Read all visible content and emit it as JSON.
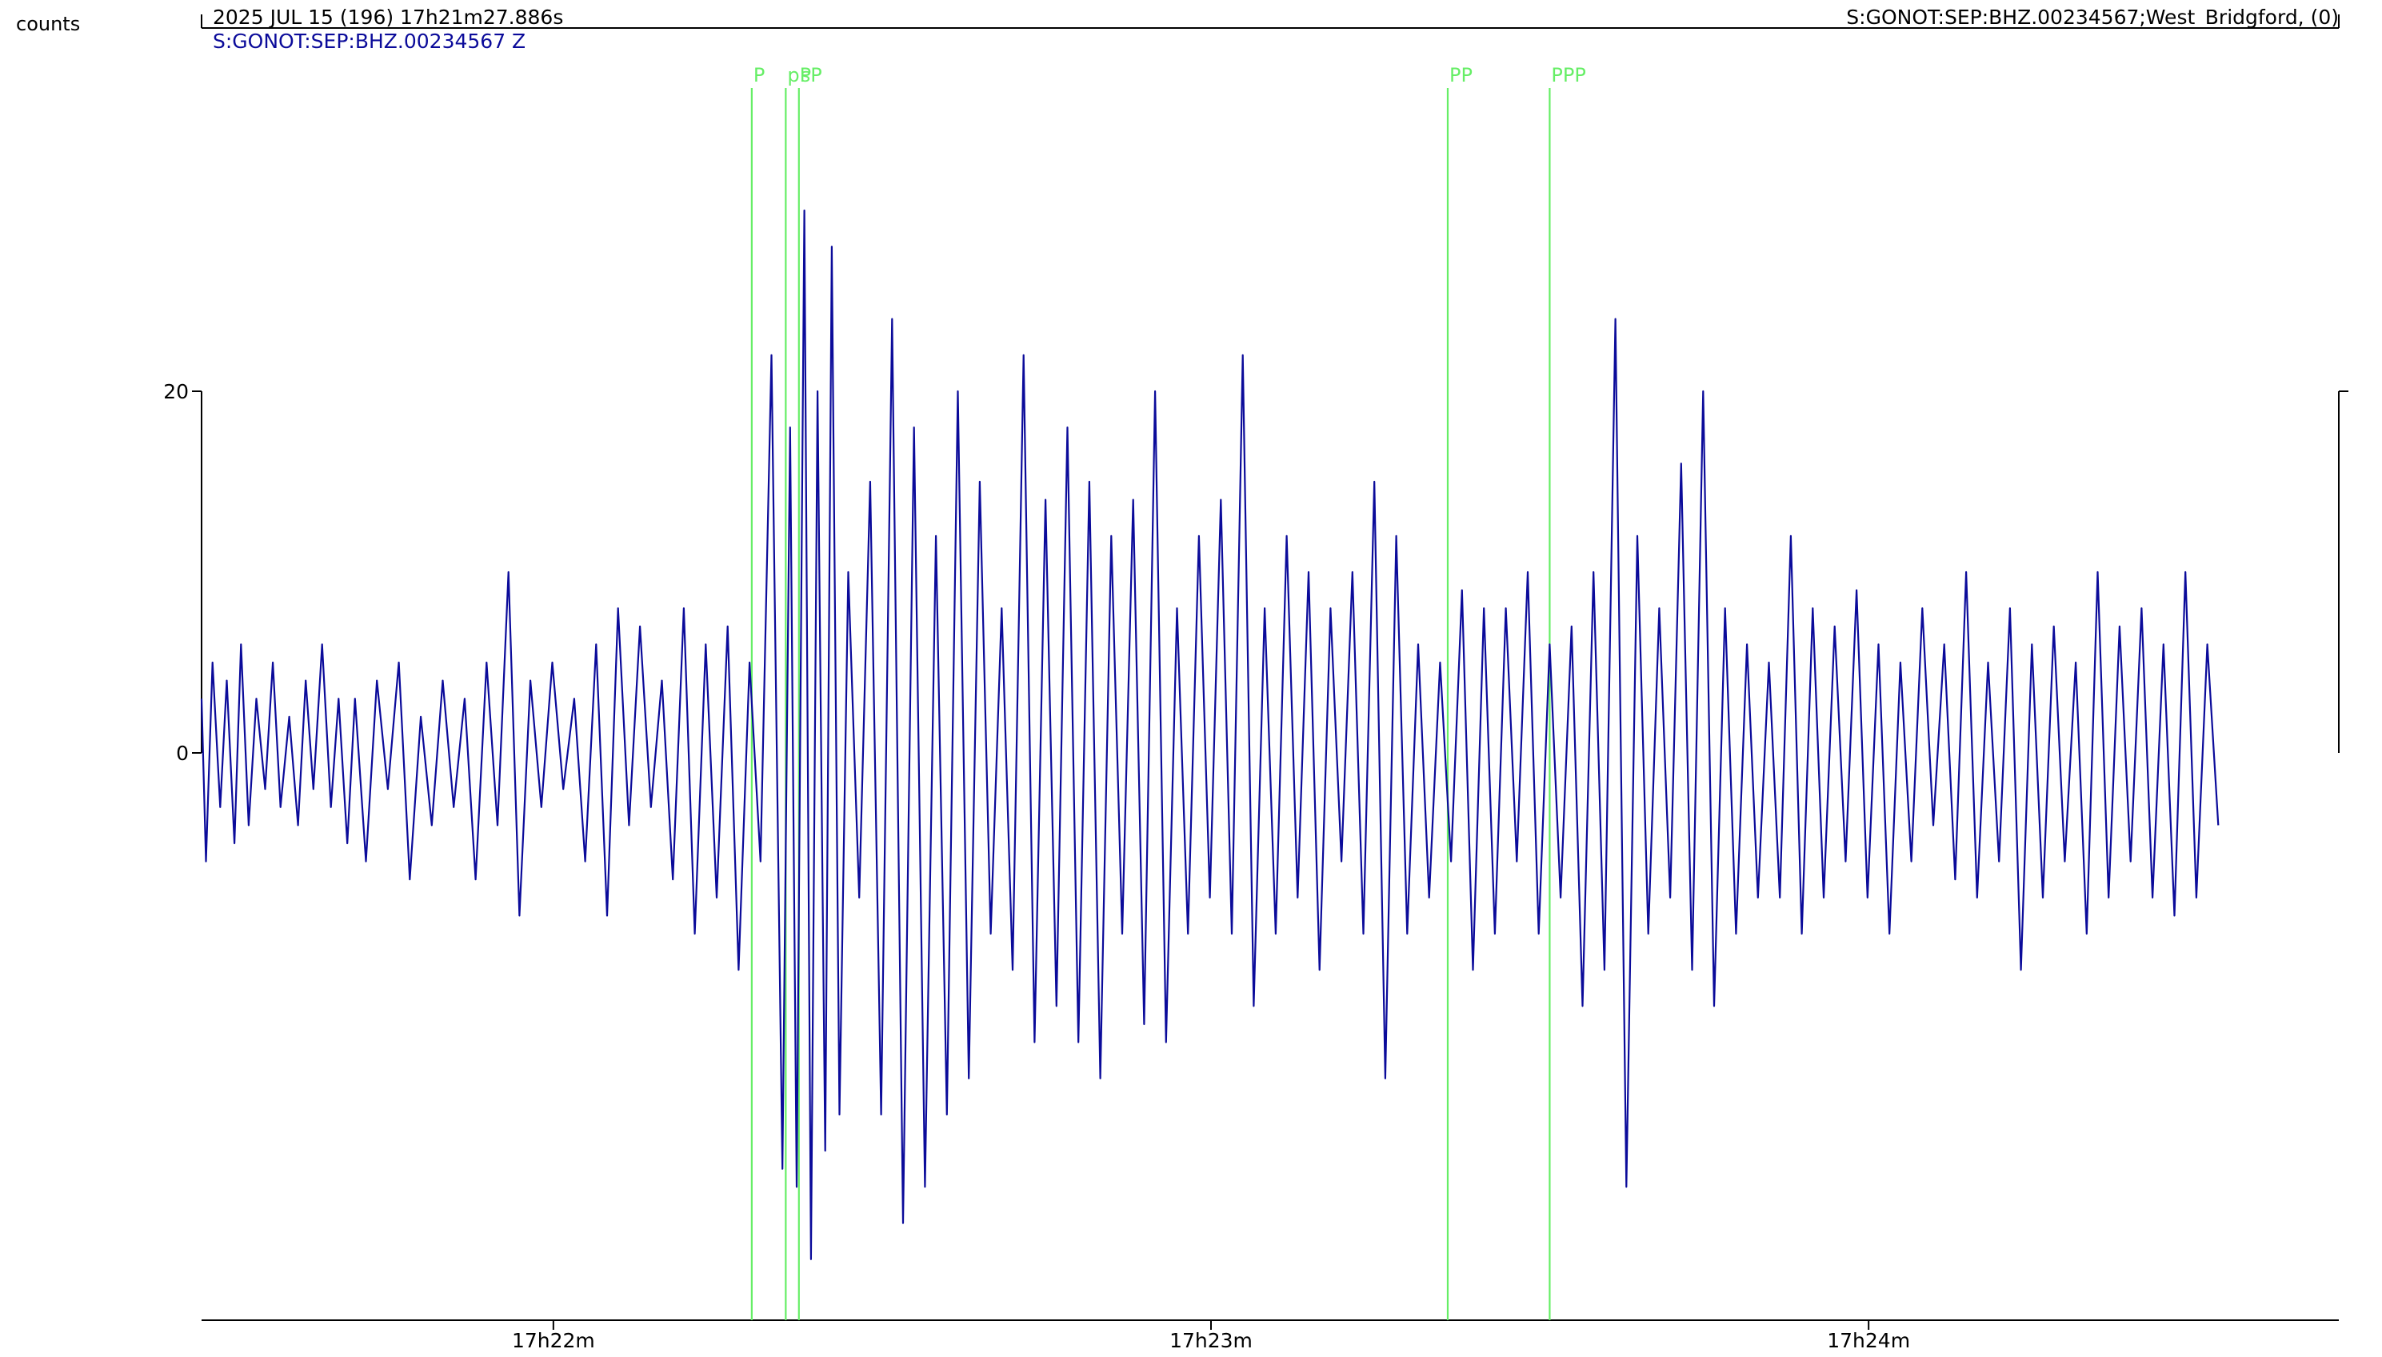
{
  "header": {
    "y_unit": "counts",
    "datetime": "2025 JUL 15 (196)  17h21m27.886s",
    "station_info": "S:GONOT:SEP:BHZ.00234567;West_Bridgford, (0)",
    "trace_label": "S:GONOT:SEP:BHZ.00234567 Z"
  },
  "colors": {
    "trace": "#0b0b9a",
    "phase_marker": "#66ee66",
    "pick": "#ee4444",
    "axis": "#000000",
    "background": "#ffffff"
  },
  "chart_data": {
    "type": "line",
    "x_unit": "seconds after 17h21m27.886s",
    "xlim": [
      0,
      195
    ],
    "ylim": [
      -40,
      40
    ],
    "y_ticks": [
      0,
      20
    ],
    "x_ticks": [
      {
        "t": 32.1,
        "label": "17h22m"
      },
      {
        "t": 92.1,
        "label": "17h23m"
      },
      {
        "t": 152.1,
        "label": "17h24m"
      }
    ],
    "phases": [
      {
        "name": "P",
        "t": 50.2
      },
      {
        "name": "pP",
        "t": 53.3
      },
      {
        "name": "sP",
        "t": 54.5
      },
      {
        "name": "PP",
        "t": 113.7
      },
      {
        "name": "PPP",
        "t": 123.0
      }
    ],
    "series": [
      {
        "t": [
          0.0,
          0.4,
          1.0,
          1.7,
          2.3,
          3.0,
          3.6,
          4.3,
          5.0,
          5.8,
          6.5,
          7.2,
          8.0,
          8.8,
          9.5,
          10.2,
          11.0,
          11.8,
          12.5,
          13.3,
          14.0,
          15.0,
          16.0,
          17.0,
          18.0,
          19.0,
          20.0,
          21.0,
          22.0,
          23.0,
          24.0,
          25.0,
          26.0,
          27.0,
          28.0,
          29.0,
          30.0,
          31.0,
          32.0,
          33.0,
          34.0,
          35.0,
          36.0,
          37.0,
          38.0,
          39.0,
          40.0,
          41.0,
          42.0,
          43.0,
          44.0,
          45.0,
          46.0,
          47.0,
          48.0,
          49.0,
          50.0,
          51.0,
          52.0,
          53.0,
          53.7,
          54.3,
          55.0,
          55.6,
          56.2,
          56.9,
          57.5,
          58.2,
          59.0,
          60.0,
          61.0,
          62.0,
          63.0,
          64.0,
          65.0,
          66.0,
          67.0,
          68.0,
          69.0,
          70.0,
          71.0,
          72.0,
          73.0,
          74.0,
          75.0,
          76.0,
          77.0,
          78.0,
          79.0,
          80.0,
          81.0,
          82.0,
          83.0,
          84.0,
          85.0,
          86.0,
          87.0,
          88.0,
          89.0,
          90.0,
          91.0,
          92.0,
          93.0,
          94.0,
          95.0,
          96.0,
          97.0,
          98.0,
          99.0,
          100.0,
          101.0,
          102.0,
          103.0,
          104.0,
          105.0,
          106.0,
          107.0,
          108.0,
          109.0,
          110.0,
          111.0,
          112.0,
          113.0,
          114.0,
          115.0,
          116.0,
          117.0,
          118.0,
          119.0,
          120.0,
          121.0,
          122.0,
          123.0,
          124.0,
          125.0,
          126.0,
          127.0,
          128.0,
          129.0,
          130.0,
          131.0,
          132.0,
          133.0,
          134.0,
          135.0,
          136.0,
          137.0,
          138.0,
          139.0,
          140.0,
          141.0,
          142.0,
          143.0,
          144.0,
          145.0,
          146.0,
          147.0,
          148.0,
          149.0,
          150.0,
          151.0,
          152.0,
          153.0,
          154.0,
          155.0,
          156.0,
          157.0,
          158.0,
          159.0,
          160.0,
          161.0,
          162.0,
          163.0,
          164.0,
          165.0,
          166.0,
          167.0,
          168.0,
          169.0,
          170.0,
          171.0,
          172.0,
          173.0,
          174.0,
          175.0,
          176.0,
          177.0,
          178.0,
          179.0,
          180.0,
          181.0,
          182.0,
          183.0,
          184.0,
          185.0,
          186.0,
          187.0,
          188.0,
          189.0,
          190.0,
          191.0,
          192.0,
          193.0,
          194.0,
          195.0
        ],
        "values": [
          3,
          -6,
          5,
          -3,
          4,
          -5,
          6,
          -4,
          3,
          -2,
          5,
          -3,
          2,
          -4,
          4,
          -2,
          6,
          -3,
          3,
          -5,
          3,
          -6,
          4,
          -2,
          5,
          -7,
          2,
          -4,
          4,
          -3,
          3,
          -7,
          5,
          -4,
          10,
          -9,
          4,
          -3,
          5,
          -2,
          3,
          -6,
          6,
          -9,
          8,
          -4,
          7,
          -3,
          4,
          -7,
          8,
          -10,
          6,
          -8,
          7,
          -12,
          5,
          -6,
          22,
          -23,
          18,
          -24,
          30,
          -28,
          20,
          -22,
          28,
          -20,
          10,
          -8,
          15,
          -20,
          24,
          -26,
          18,
          -24,
          12,
          -20,
          20,
          -18,
          15,
          -10,
          8,
          -12,
          22,
          -16,
          14,
          -14,
          18,
          -16,
          15,
          -18,
          12,
          -10,
          14,
          -15,
          20,
          -16,
          8,
          -10,
          12,
          -8,
          14,
          -10,
          22,
          -14,
          8,
          -10,
          12,
          -8,
          10,
          -12,
          8,
          -6,
          10,
          -10,
          15,
          -18,
          12,
          -10,
          6,
          -8,
          5,
          -6,
          9,
          -12,
          8,
          -10,
          8,
          -6,
          10,
          -10,
          6,
          -8,
          7,
          -14,
          10,
          -12,
          24,
          -24,
          12,
          -10,
          8,
          -8,
          16,
          -12,
          20,
          -14,
          8,
          -10,
          6,
          -8,
          5,
          -8,
          12,
          -10,
          8,
          -8,
          7,
          -6,
          9,
          -8,
          6,
          -10,
          5,
          -6,
          8,
          -4,
          6,
          -7,
          10,
          -8,
          5,
          -6,
          8,
          -12,
          6,
          -8,
          7,
          -6,
          5,
          -10,
          10,
          -8,
          7,
          -6,
          8,
          -8,
          6,
          -9,
          10,
          -8,
          6,
          -4
        ]
      }
    ]
  }
}
